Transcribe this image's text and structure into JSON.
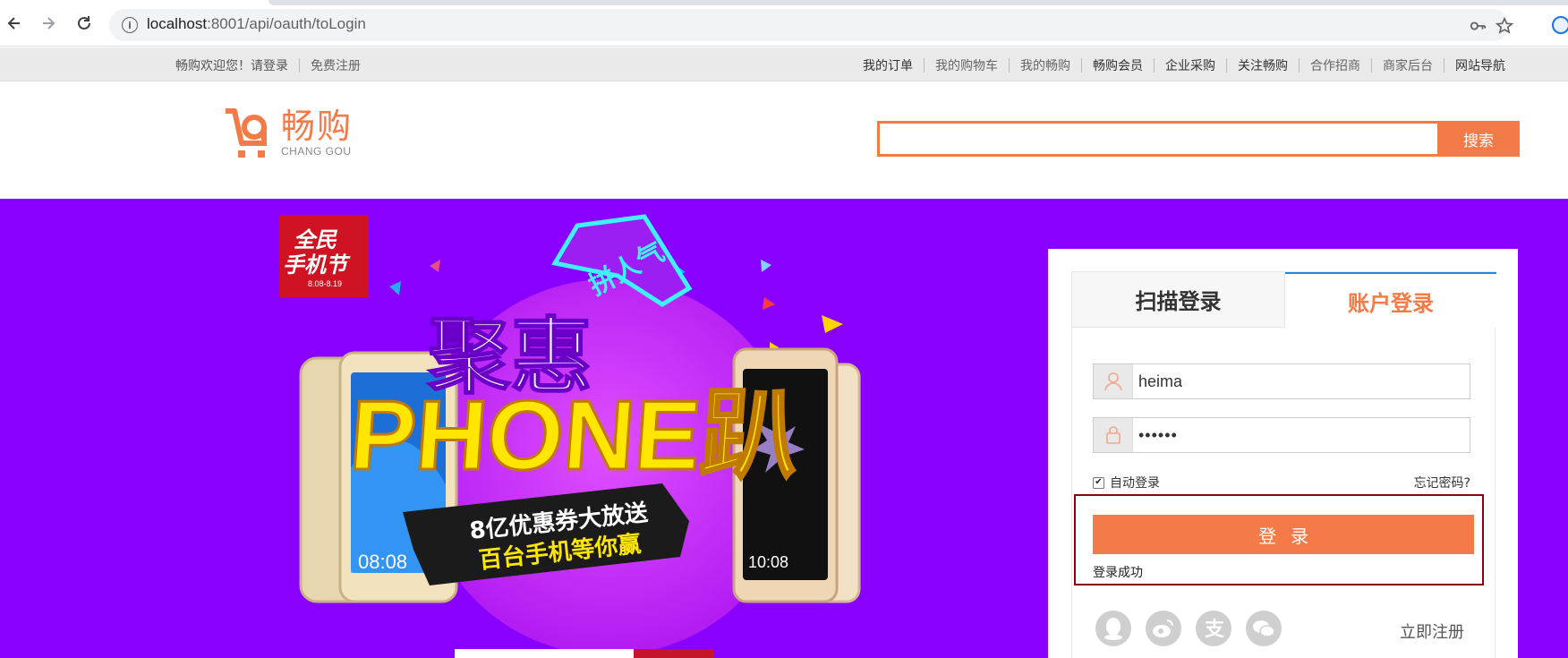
{
  "browser": {
    "url_host": "localhost",
    "url_path": ":8001/api/oauth/toLogin"
  },
  "topbar": {
    "welcome": "畅购欢迎您！",
    "login_link": "请登录",
    "register_link": "免费注册",
    "links": [
      "我的订单",
      "我的购物车",
      "我的畅购",
      "畅购会员",
      "企业采购",
      "关注畅购",
      "合作招商",
      "商家后台",
      "网站导航"
    ]
  },
  "header": {
    "logo_cn": "畅购",
    "logo_en": "CHANG GOU",
    "search_value": "",
    "search_button": "搜索"
  },
  "banner": {
    "badge_line1": "全民",
    "badge_line2": "手机节",
    "badge_dates": "8.08-8.19",
    "ribbon": "拼人气",
    "headline": "聚惠",
    "phone_word": "PHONE趴",
    "subline1": "8亿优惠券大放送",
    "subline2": "百台手机等你赢",
    "phone_left_time": "08:08",
    "phone_right_time": "10:08"
  },
  "login": {
    "tab_scan": "扫描登录",
    "tab_account": "账户登录",
    "username_value": "heima",
    "password_value": "••••••",
    "auto_login_label": "自动登录",
    "auto_login_checked": true,
    "forgot_link": "忘记密码?",
    "submit_label": "登录",
    "status_message": "登录成功",
    "register_link": "立即注册",
    "social_icons": [
      "qq-icon",
      "weibo-icon",
      "alipay-icon",
      "wechat-icon"
    ]
  },
  "colors": {
    "brand": "#f47b47",
    "banner_bg": "#8a00ff",
    "highlight": "#8b0010",
    "active_tab_border": "#1e88e5"
  }
}
